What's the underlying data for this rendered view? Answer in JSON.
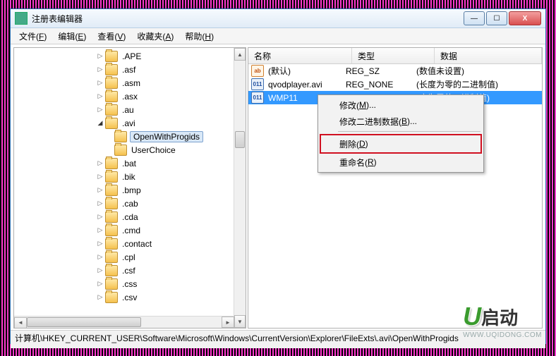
{
  "window": {
    "title": "注册表编辑器"
  },
  "menubar": [
    {
      "label": "文件",
      "accel": "F"
    },
    {
      "label": "编辑",
      "accel": "E"
    },
    {
      "label": "查看",
      "accel": "V"
    },
    {
      "label": "收藏夹",
      "accel": "A"
    },
    {
      "label": "帮助",
      "accel": "H"
    }
  ],
  "tree": [
    {
      "depth": 9,
      "exp": "►",
      "name": ".APE"
    },
    {
      "depth": 9,
      "exp": "►",
      "name": ".asf"
    },
    {
      "depth": 9,
      "exp": "►",
      "name": ".asm"
    },
    {
      "depth": 9,
      "exp": "►",
      "name": ".asx"
    },
    {
      "depth": 9,
      "exp": "►",
      "name": ".au"
    },
    {
      "depth": 9,
      "exp": "▢",
      "name": ".avi",
      "expanded": true
    },
    {
      "depth": 10,
      "exp": "",
      "name": "OpenWithProgids",
      "selected": true
    },
    {
      "depth": 10,
      "exp": "",
      "name": "UserChoice"
    },
    {
      "depth": 9,
      "exp": "►",
      "name": ".bat"
    },
    {
      "depth": 9,
      "exp": "►",
      "name": ".bik"
    },
    {
      "depth": 9,
      "exp": "►",
      "name": ".bmp"
    },
    {
      "depth": 9,
      "exp": "►",
      "name": ".cab"
    },
    {
      "depth": 9,
      "exp": "►",
      "name": ".cda"
    },
    {
      "depth": 9,
      "exp": "►",
      "name": ".cmd"
    },
    {
      "depth": 9,
      "exp": "►",
      "name": ".contact"
    },
    {
      "depth": 9,
      "exp": "►",
      "name": ".cpl"
    },
    {
      "depth": 9,
      "exp": "►",
      "name": ".csf"
    },
    {
      "depth": 9,
      "exp": "►",
      "name": ".css"
    },
    {
      "depth": 9,
      "exp": "►",
      "name": ".csv"
    }
  ],
  "list": {
    "headers": {
      "name": "名称",
      "type": "类型",
      "data": "数据"
    },
    "rows": [
      {
        "icon": "str",
        "name": "(默认)",
        "type": "REG_SZ",
        "data": "(数值未设置)"
      },
      {
        "icon": "bin",
        "name": "qvodplayer.avi",
        "type": "REG_NONE",
        "data": "(长度为零的二进制值)"
      },
      {
        "icon": "bin",
        "name": "WMP11",
        "type": "",
        "data": "(度为零的二进制值)",
        "selected": true
      }
    ]
  },
  "contextmenu": [
    {
      "label": "修改",
      "accel": "M",
      "suffix": "..."
    },
    {
      "label": "修改二进制数据",
      "accel": "B",
      "suffix": "..."
    },
    {
      "sep": true
    },
    {
      "label": "删除",
      "accel": "D",
      "highlight": true
    },
    {
      "label": "重命名",
      "accel": "R"
    }
  ],
  "statusbar": "计算机\\HKEY_CURRENT_USER\\Software\\Microsoft\\Windows\\CurrentVersion\\Explorer\\FileExts\\.avi\\OpenWithProgids",
  "watermark": {
    "brand_hanzi": "启动",
    "url": "WWW.UQIDONG.COM"
  }
}
